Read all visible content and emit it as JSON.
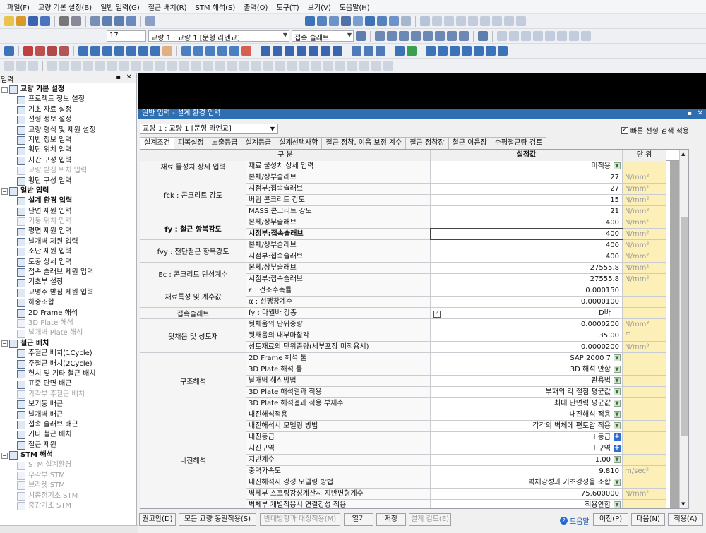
{
  "menu": [
    "파일(F)",
    "교량 기본 설정(B)",
    "일반 입력(G)",
    "철근 배치(R)",
    "STM 해석(S)",
    "출력(O)",
    "도구(T)",
    "보기(V)",
    "도움말(H)"
  ],
  "toolbar2": {
    "number": "17",
    "bridge_select": "교량 1 : 교량 1 [문형 라멘교]",
    "member_select": "접속 슬래브"
  },
  "left_panel": {
    "title": "입력",
    "groups": [
      {
        "label": "교량 기본 설정",
        "items": [
          {
            "label": "프로젝트 정보 설정",
            "enabled": true
          },
          {
            "label": "기초 자료 설정",
            "enabled": true
          },
          {
            "label": "선형 정보 설정",
            "enabled": true
          },
          {
            "label": "교량 형식 및 제원 설정",
            "enabled": true
          },
          {
            "label": "지반 정보 입력",
            "enabled": true
          },
          {
            "label": "횡단 위치 입력",
            "enabled": true
          },
          {
            "label": "지간 구성 입력",
            "enabled": true
          },
          {
            "label": "교량 받침 위치 입력",
            "enabled": false
          },
          {
            "label": "횡단 구성 입력",
            "enabled": true
          }
        ]
      },
      {
        "label": "일반 입력",
        "items": [
          {
            "label": "설계 환경 입력",
            "enabled": true,
            "bold": true
          },
          {
            "label": "단면 제원 입력",
            "enabled": true
          },
          {
            "label": "기둥 위치 입력",
            "enabled": false
          },
          {
            "label": "평면 제원 입력",
            "enabled": true
          },
          {
            "label": "날개벽 제원 입력",
            "enabled": true
          },
          {
            "label": "소단 제원 입력",
            "enabled": true
          },
          {
            "label": "토공 상세 입력",
            "enabled": true
          },
          {
            "label": "접속 슬래브 제원 입력",
            "enabled": true
          },
          {
            "label": "기초부 설정",
            "enabled": true
          },
          {
            "label": "교명주 받침 제원 입력",
            "enabled": true
          },
          {
            "label": "하중조합",
            "enabled": true
          },
          {
            "label": "2D Frame 해석",
            "enabled": true
          },
          {
            "label": "3D Plate 해석",
            "enabled": false
          },
          {
            "label": "날개벽 Plate 해석",
            "enabled": false
          }
        ]
      },
      {
        "label": "철근 배치",
        "items": [
          {
            "label": "주철근 배치(1Cycle)",
            "enabled": true
          },
          {
            "label": "주철근 배치(2Cycle)",
            "enabled": true
          },
          {
            "label": "헌치 및 기타 철근 배치",
            "enabled": true
          },
          {
            "label": "표준 단면 배근",
            "enabled": true
          },
          {
            "label": "가각부 주철근 배치",
            "enabled": false
          },
          {
            "label": "보기둥 배근",
            "enabled": true
          },
          {
            "label": "날개벽 배근",
            "enabled": true
          },
          {
            "label": "접속 슬래브 배근",
            "enabled": true
          },
          {
            "label": "기타 철근 배치",
            "enabled": true
          },
          {
            "label": "철근 제원",
            "enabled": true
          }
        ]
      },
      {
        "label": "STM 해석",
        "items": [
          {
            "label": "STM 설계환경",
            "enabled": false
          },
          {
            "label": "우각부 STM",
            "enabled": false
          },
          {
            "label": "브라켓 STM",
            "enabled": false
          },
          {
            "label": "시종점기초 STM",
            "enabled": false
          },
          {
            "label": "중간기초 STM",
            "enabled": false
          }
        ]
      }
    ]
  },
  "dialog": {
    "title": "일반 입력 - 설계 환경 입력",
    "bridge": "교량 1 : 교량 1 [문형 라멘교]",
    "quick_search": "빠른 선형 검색 적용",
    "tabs": [
      "설계조건",
      "피복설정",
      "노출등급",
      "설계등급",
      "설계선택사항",
      "철근 정착, 이음 보정 계수",
      "철근 정착장",
      "철근 이음장",
      "수평철근량 검토"
    ],
    "headers": {
      "group": "구 분",
      "value": "설정값",
      "unit": "단 위"
    },
    "groups": [
      {
        "label": "재료 물성치 상세 입력",
        "rows": 1
      },
      {
        "label": "fck : 콘크리트 강도",
        "rows": 4
      },
      {
        "label": "fy : 철근 항복강도",
        "rows": 2,
        "bold": true
      },
      {
        "label": "fvy : 전단철근 항복강도",
        "rows": 2
      },
      {
        "label": "Ec : 콘크리트 탄성계수",
        "rows": 2
      },
      {
        "label": "재료특성 및 계수값",
        "rows": 2
      },
      {
        "label": "접속슬래브",
        "rows": 1
      },
      {
        "label": "뒷채움 및 성토재",
        "rows": 3
      },
      {
        "label": "구조해석",
        "rows": 5
      },
      {
        "label": "내진해석",
        "rows": 9
      }
    ],
    "rows": [
      {
        "sub": "재료 물성치 상세 입력",
        "value": "미적용",
        "unit": "",
        "ctrl": "dd"
      },
      {
        "sub": "본체/상부슬래브",
        "value": "27",
        "unit": "N/mm²",
        "ctrl": ""
      },
      {
        "sub": "시점부:접속슬래브",
        "value": "27",
        "unit": "N/mm²",
        "ctrl": ""
      },
      {
        "sub": "버림 콘크리트 강도",
        "value": "15",
        "unit": "N/mm²",
        "ctrl": ""
      },
      {
        "sub": "MASS 콘크리트 강도",
        "value": "21",
        "unit": "N/mm²",
        "ctrl": ""
      },
      {
        "sub": "본체/상부슬래브",
        "value": "400",
        "unit": "N/mm²",
        "ctrl": ""
      },
      {
        "sub": "시점부:접속슬래브",
        "value": "400",
        "unit": "N/mm²",
        "ctrl": "",
        "bold": true
      },
      {
        "sub": "본체/상부슬래브",
        "value": "400",
        "unit": "N/mm²",
        "ctrl": ""
      },
      {
        "sub": "시점부:접속슬래브",
        "value": "400",
        "unit": "N/mm²",
        "ctrl": ""
      },
      {
        "sub": "본체/상부슬래브",
        "value": "27555.8",
        "unit": "N/mm²",
        "ctrl": ""
      },
      {
        "sub": "시점부:접속슬래브",
        "value": "27555.8",
        "unit": "N/mm²",
        "ctrl": ""
      },
      {
        "sub": "ε : 건조수축률",
        "value": "0.000150",
        "unit": "",
        "ctrl": ""
      },
      {
        "sub": "α : 선팽창계수",
        "value": "0.0000100",
        "unit": "",
        "ctrl": ""
      },
      {
        "sub": "fy : 다월바 강종",
        "value": "D바",
        "unit": "",
        "ctrl": "chk"
      },
      {
        "sub": "뒷채움의 단위중량",
        "value": "0.0000200",
        "unit": "N/mm³",
        "ctrl": ""
      },
      {
        "sub": "뒷채움의 내부마찰각",
        "value": "35.00",
        "unit": "도",
        "ctrl": ""
      },
      {
        "sub": "성토재료의 단위중량(세부포장 미적용시)",
        "value": "0.0000200",
        "unit": "N/mm³",
        "ctrl": ""
      },
      {
        "sub": "2D Frame 해석 툴",
        "value": "SAP 2000 7",
        "unit": "",
        "ctrl": "dd"
      },
      {
        "sub": "3D Plate 해석 툴",
        "value": "3D 해석 안함",
        "unit": "",
        "ctrl": "dd"
      },
      {
        "sub": "날개벽 해석방법",
        "value": "관용법",
        "unit": "",
        "ctrl": "dd"
      },
      {
        "sub": "3D Plate 해석결과 적용",
        "value": "부재의 각 절점 평균값",
        "unit": "",
        "ctrl": "dd"
      },
      {
        "sub": "3D Plate 해석결과 적용 부재수",
        "value": "최대 단면력 평균값",
        "unit": "",
        "ctrl": "dd"
      },
      {
        "sub": "내진해석적용",
        "value": "내진해석 적용",
        "unit": "",
        "ctrl": "dd"
      },
      {
        "sub": "내진해석시 모델링 방법",
        "value": "각각의 벽체에 편토압 적용",
        "unit": "",
        "ctrl": "dd"
      },
      {
        "sub": "내진등급",
        "value": "I 등급",
        "unit": "",
        "ctrl": "plus"
      },
      {
        "sub": "지진구역",
        "value": "I 구역",
        "unit": "",
        "ctrl": "plus"
      },
      {
        "sub": "지반계수",
        "value": "1.00",
        "unit": "",
        "ctrl": "dd"
      },
      {
        "sub": "중력가속도",
        "value": "9.810",
        "unit": "m/sec²",
        "ctrl": ""
      },
      {
        "sub": "내진해석시 강성 모델링 방법",
        "value": "벽체강성과 기초강성을 조합",
        "unit": "",
        "ctrl": "dd"
      },
      {
        "sub": "벽체부 스프링강성계산시 지반변형계수",
        "value": "75.600000",
        "unit": "N/mm²",
        "ctrl": ""
      },
      {
        "sub": "벽체부 개별적용시 연결강성 적용",
        "value": "적용안함",
        "unit": "",
        "ctrl": "dd"
      }
    ],
    "buttons": {
      "recommend": "권고안(D)",
      "all_bridges": "모든 교량 동일적용(S)",
      "reverse": "반대방향과 대칭적용(M)",
      "open": "열기",
      "save": "저장",
      "check": "설계 검토(E)",
      "help": "도움말",
      "prev": "이전(P)",
      "next": "다음(N)",
      "apply": "적용(A)"
    }
  }
}
